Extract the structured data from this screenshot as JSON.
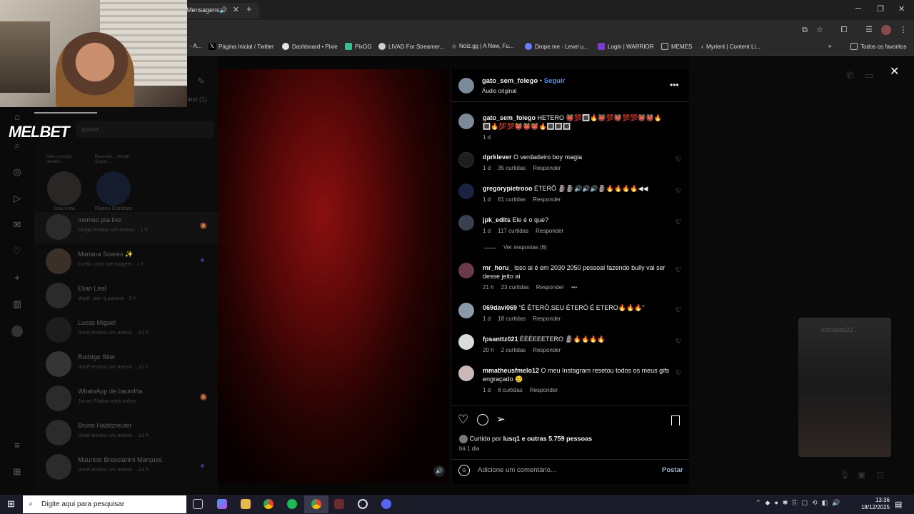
{
  "browser": {
    "tab_title": "Mensagens",
    "bookmarks": [
      "Página Inicial / Twitter",
      "Dashboard • Pixie",
      "PixGG",
      "LIVAD For Streamer...",
      "Noiz.gg | A New, Fu...",
      "Drope.me - Level u...",
      "Login | WARRIOR",
      "MEMES",
      "Myrient | Content Li...",
      "Todos os favoritos"
    ],
    "bookmark_partial": "- A..."
  },
  "overlay": {
    "brand": "MELBET"
  },
  "dm_sidebar": {
    "header_count": "xiest (1)",
    "search_placeholder": "quisar",
    "notes": [
      {
        "label": "Sua nota",
        "note": "Não consigo decidir..."
      },
      {
        "label": "Ryann Cardozo",
        "note": "Reunião... Vergh, Super..."
      }
    ],
    "conversations": [
      {
        "name": "memes pra live",
        "subtitle": "Diogo enviou um anexo. · 1 h"
      },
      {
        "name": "Mariana Soares ✨",
        "subtitle": "Curtiu uma mensagem · 1 h"
      },
      {
        "name": "Elian Leal",
        "subtitle": "Você: pior q parece · 3 h"
      },
      {
        "name": "Lucas Miguel",
        "subtitle": "Você enviou um anexo. · 12 h"
      },
      {
        "name": "Rodrigo Stier",
        "subtitle": "Você enviou um anexo. · 12 h"
      },
      {
        "name": "WhatsApp de baunilha",
        "subtitle": "Jonas Pádua está online"
      },
      {
        "name": "Bruno Habitzreuter",
        "subtitle": "Você enviou um anexo. · 13 h"
      },
      {
        "name": "Mauricio Brescianini Marques",
        "subtitle": "Você enviou um anexo. · 13 h"
      }
    ]
  },
  "post": {
    "author": "gato_sem_folego",
    "follow": "Seguir",
    "audio": "Áudio original",
    "caption_user": "gato_sem_folego",
    "caption_text": "HETERO 👹💯🔳🔥👹💯👹💯💯👹👹🔥🔳🔥💯💯👹👹👹🔥🔳🔳🔳",
    "caption_time": "1 d",
    "comments": [
      {
        "user": "dprklever",
        "text": "O verdadeiro boy magia",
        "time": "1 d",
        "likes": "35 curtidas",
        "reply": "Responder"
      },
      {
        "user": "gregorypietrooo",
        "text": "ÉTERÔ 🗿🗿🔊🔊🔊🗿🔥🔥🔥🔥◀◀",
        "time": "1 d",
        "likes": "61 curtidas",
        "reply": "Responder"
      },
      {
        "user": "jpk_edits",
        "text": "Ele é o que?",
        "time": "1 d",
        "likes": "117 curtidas",
        "reply": "Responder",
        "view_replies": "Ver respostas (8)"
      },
      {
        "user": "mr_horu_",
        "text": "Isso ai é em 2030 2050 pessoal fazendo bully vai ser desse jeito ai",
        "time": "21 h",
        "likes": "23 curtidas",
        "reply": "Responder",
        "more": "•••"
      },
      {
        "user": "069davi069",
        "text": "\"É ÉTERÓ,SEU ÉTERÓ É ETERO🔥🔥🔥\"",
        "time": "1 d",
        "likes": "18 curtidas",
        "reply": "Responder"
      },
      {
        "user": "fpsanttz021",
        "text": "ÉÉÉEEETERO 🗿🔥🔥🔥🔥",
        "time": "20 h",
        "likes": "2 curtidas",
        "reply": "Responder"
      },
      {
        "user": "mmatheusfmelo12",
        "text": "O meu Instagram resetou todos os meus gifs engraçado 😢",
        "time": "1 d",
        "likes": "6 curtidas",
        "reply": "Responder"
      }
    ],
    "liked_by_prefix": "Curtido por",
    "liked_by_user": "lusq1",
    "liked_by_rest": "e outras 5.759 pessoas",
    "age": "há 1 dia",
    "comment_placeholder": "Adicione um comentário...",
    "post_button": "Postar"
  },
  "side": {
    "cortadas_label": "cortadas22"
  },
  "taskbar": {
    "search_placeholder": "Digite aqui para pesquisar",
    "time": "13:36",
    "date": "18/12/2025"
  }
}
